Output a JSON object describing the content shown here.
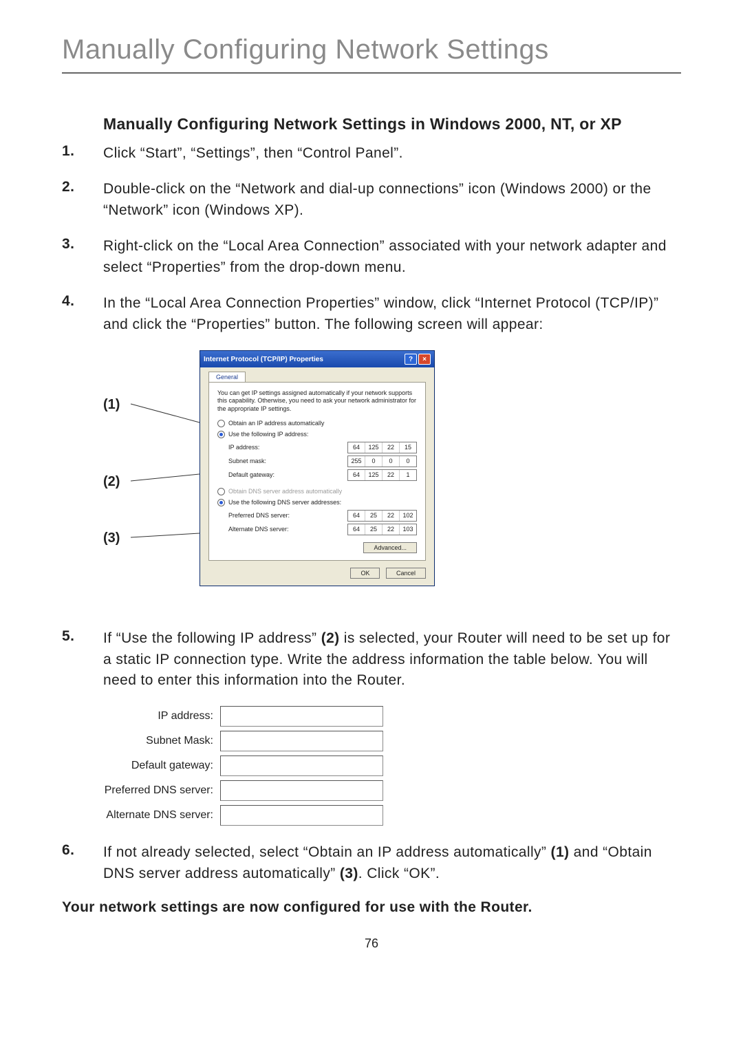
{
  "page_title": "Manually Configuring Network Settings",
  "section_title": "Manually Configuring Network Settings in Windows 2000, NT, or XP",
  "steps": {
    "s1": {
      "num": "1.",
      "text": "Click “Start”, “Settings”, then “Control Panel”."
    },
    "s2": {
      "num": "2.",
      "text": "Double-click on the “Network and dial-up connections” icon (Windows 2000) or the “Network” icon (Windows XP)."
    },
    "s3": {
      "num": "3.",
      "text": "Right-click on the “Local Area Connection” associated with your network adapter and select “Properties” from the drop-down menu."
    },
    "s4": {
      "num": "4.",
      "text": "In the “Local Area Connection Properties” window, click “Internet Protocol (TCP/IP)” and click the “Properties” button. The following screen will appear:"
    },
    "s5": {
      "num": "5.",
      "pre": "If “Use the following IP address” ",
      "ref": "(2)",
      "post": " is selected, your Router will need to be set up for a static IP connection type. Write the address information the table below. You will need to enter this information into the Router."
    },
    "s6": {
      "num": "6.",
      "a": "If not already selected, select “Obtain an IP address automatically” ",
      "r1": "(1)",
      "b": " and “Obtain DNS server address automatically” ",
      "r2": "(3)",
      "c": ". Click “OK”."
    }
  },
  "closing": "Your network settings are now configured for use with the Router.",
  "page_number": "76",
  "callout_labels": {
    "c1": "(1)",
    "c2": "(2)",
    "c3": "(3)"
  },
  "dialog": {
    "title": "Internet Protocol (TCP/IP) Properties",
    "tab": "General",
    "info": "You can get IP settings assigned automatically if your network supports this capability. Otherwise, you need to ask your network administrator for the appropriate IP settings.",
    "radio_auto_ip": "Obtain an IP address automatically",
    "radio_use_ip": "Use the following IP address:",
    "ip_address_lbl": "IP address:",
    "ip_address": [
      "64",
      "125",
      "22",
      "15"
    ],
    "subnet_lbl": "Subnet mask:",
    "subnet": [
      "255",
      "0",
      "0",
      "0"
    ],
    "gateway_lbl": "Default gateway:",
    "gateway": [
      "64",
      "125",
      "22",
      "1"
    ],
    "radio_auto_dns": "Obtain DNS server address automatically",
    "radio_use_dns": "Use the following DNS server addresses:",
    "pref_dns_lbl": "Preferred DNS server:",
    "pref_dns": [
      "64",
      "25",
      "22",
      "102"
    ],
    "alt_dns_lbl": "Alternate DNS server:",
    "alt_dns": [
      "64",
      "25",
      "22",
      "103"
    ],
    "advanced": "Advanced...",
    "ok": "OK",
    "cancel": "Cancel"
  },
  "blank_table": {
    "ip": "IP address:",
    "subnet": "Subnet Mask:",
    "gateway": "Default gateway:",
    "pref": "Preferred DNS server:",
    "alt": "Alternate DNS server:"
  }
}
